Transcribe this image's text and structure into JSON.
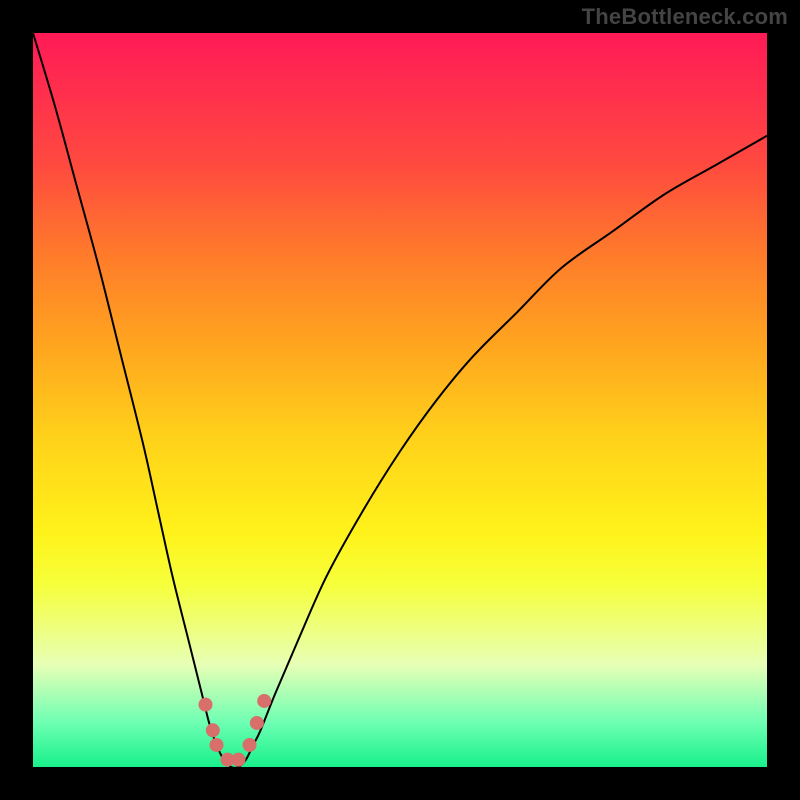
{
  "watermark": "TheBottleneck.com",
  "chart_data": {
    "type": "line",
    "title": "",
    "xlabel": "",
    "ylabel": "",
    "xlim": [
      0,
      100
    ],
    "ylim": [
      0,
      100
    ],
    "series": [
      {
        "name": "curve",
        "x": [
          0,
          3,
          6,
          9,
          12,
          15,
          17,
          19,
          21,
          23,
          24,
          25,
          26,
          27,
          28,
          29,
          30,
          31,
          33,
          36,
          40,
          45,
          50,
          55,
          60,
          66,
          72,
          79,
          86,
          93,
          100
        ],
        "y": [
          100,
          90,
          79,
          68,
          56,
          44,
          35,
          26,
          18,
          10,
          6,
          3,
          1,
          0,
          0,
          1,
          3,
          5,
          10,
          17,
          26,
          35,
          43,
          50,
          56,
          62,
          68,
          73,
          78,
          82,
          86
        ]
      }
    ],
    "markers": {
      "name": "dip-cluster",
      "x": [
        23.5,
        24.5,
        25.0,
        26.5,
        28.0,
        29.5,
        30.5,
        31.5
      ],
      "y": [
        8.5,
        5.0,
        3.0,
        1.0,
        1.0,
        3.0,
        6.0,
        9.0
      ]
    },
    "background": {
      "type": "vertical-gradient",
      "stops": [
        {
          "pos": 0.0,
          "color": "#ff1a56"
        },
        {
          "pos": 0.3,
          "color": "#ff7a2b"
        },
        {
          "pos": 0.55,
          "color": "#ffd11a"
        },
        {
          "pos": 0.75,
          "color": "#f6ff3a"
        },
        {
          "pos": 0.94,
          "color": "#6dffb3"
        },
        {
          "pos": 1.0,
          "color": "#17f08a"
        }
      ]
    },
    "frame": {
      "color": "#000000",
      "thickness_px": 33
    }
  }
}
